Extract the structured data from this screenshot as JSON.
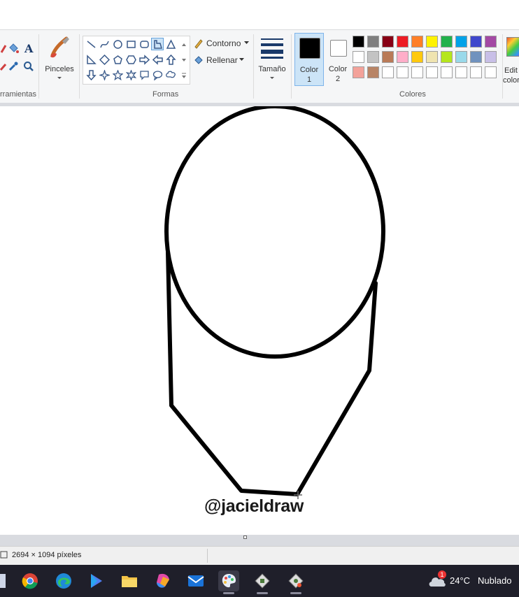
{
  "ribbon": {
    "tools_label_partial": "rramientas",
    "brushes_label": "Pinceles",
    "shapes_label": "Formas",
    "outline_label": "Contorno",
    "fill_label": "Rellenar",
    "size_label": "Tamaño",
    "color1_label_a": "Color",
    "color1_label_b": "1",
    "color2_label_a": "Color",
    "color2_label_b": "2",
    "colors_label": "Colores",
    "edit_colors_label_a": "Edit",
    "edit_colors_label_b": "color",
    "color1_value": "#000000",
    "color2_value": "#ffffff",
    "palette_row1": [
      "#000000",
      "#7f7f7f",
      "#880015",
      "#ed1c24",
      "#ff7f27",
      "#fff200",
      "#22b14c",
      "#00a2e8",
      "#3f48cc",
      "#a349a4"
    ],
    "palette_row2": [
      "#ffffff",
      "#c3c3c3",
      "#b97a57",
      "#ffaec9",
      "#ffc90e",
      "#efe4b0",
      "#b5e61d",
      "#99d9ea",
      "#7092be",
      "#c8bfe7"
    ],
    "palette_row3": [
      "#f3a29a",
      "#b88466",
      "#ffffff",
      "#ffffff",
      "#ffffff",
      "#ffffff",
      "#ffffff",
      "#ffffff",
      "#ffffff",
      "#ffffff"
    ]
  },
  "canvas": {
    "watermark": "@jacieldraw"
  },
  "status": {
    "dimensions": "2694 × 1094 píxeles"
  },
  "taskbar": {
    "weather_temp": "24°C",
    "weather_desc": "Nublado",
    "notification_count": "1"
  }
}
